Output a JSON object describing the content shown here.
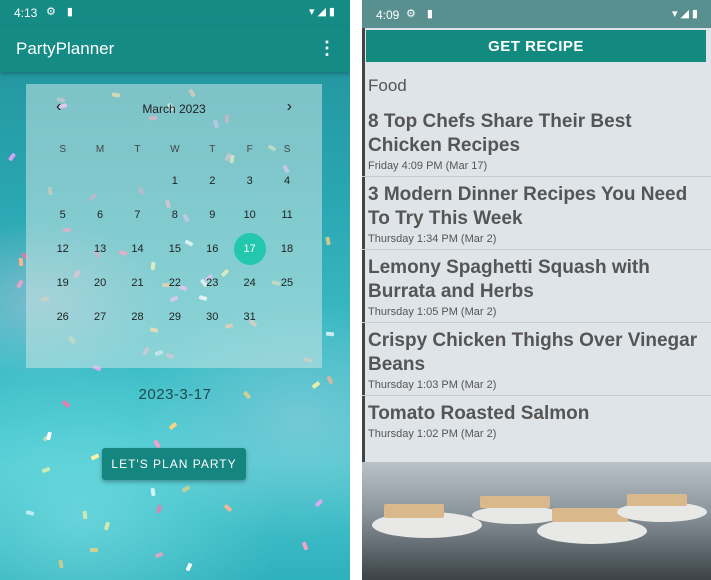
{
  "left": {
    "status": {
      "time": "4:13",
      "left_icons": "⚙ ▮",
      "right_icons": "▾◢▮"
    },
    "app_title": "PartyPlanner",
    "menu_icon": "⋮",
    "calendar": {
      "month_label": "March 2023",
      "prev_icon": "‹",
      "next_icon": "›",
      "weekdays": [
        "S",
        "M",
        "T",
        "W",
        "T",
        "F",
        "S"
      ],
      "days": [
        [
          "",
          "",
          "",
          "1",
          "2",
          "3",
          "4"
        ],
        [
          "5",
          "6",
          "7",
          "8",
          "9",
          "10",
          "11"
        ],
        [
          "12",
          "13",
          "14",
          "15",
          "16",
          "17",
          "18"
        ],
        [
          "19",
          "20",
          "21",
          "22",
          "23",
          "24",
          "25"
        ],
        [
          "26",
          "27",
          "28",
          "29",
          "30",
          "31",
          ""
        ]
      ],
      "selected_day": "17",
      "selected_color": "#22c7ad"
    },
    "selected_date_text": "2023-3-17",
    "plan_button_label": "LET'S PLAN PARTY",
    "accent_color": "#158b86"
  },
  "right": {
    "status": {
      "time": "4:09",
      "left_icons": "⚙ ▮",
      "right_icons": "▾◢▮"
    },
    "get_recipe_label": "GET RECIPE",
    "section_title": "Food",
    "articles": [
      {
        "title": "8 Top Chefs Share Their Best Chicken Recipes",
        "date": "Friday 4:09 PM (Mar 17)"
      },
      {
        "title": "3 Modern Dinner Recipes You Need To Try This Week",
        "date": "Thursday 1:34 PM (Mar 2)"
      },
      {
        "title": "Lemony Spaghetti Squash with Burrata and Herbs",
        "date": "Thursday 1:05 PM (Mar 2)"
      },
      {
        "title": "Crispy Chicken Thighs Over Vinegar Beans",
        "date": "Thursday 1:03 PM (Mar 2)"
      },
      {
        "title": "Tomato Roasted Salmon",
        "date": "Thursday 1:02 PM (Mar 2)"
      }
    ],
    "accent_color": "#138a80"
  }
}
